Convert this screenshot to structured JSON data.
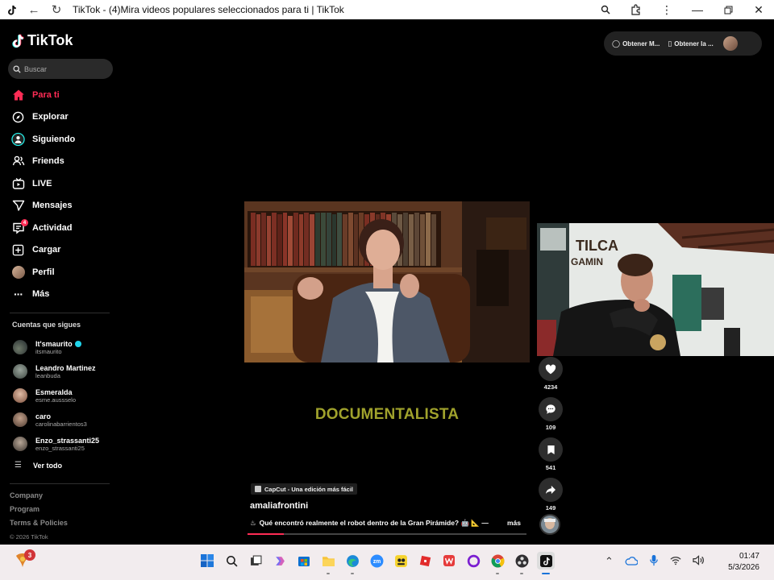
{
  "browser": {
    "title": "TikTok - (4)Mira videos populares seleccionados para ti | TikTok"
  },
  "sidebar": {
    "logo_text": "TikTok",
    "search_placeholder": "Buscar",
    "nav": [
      {
        "label": "Para ti",
        "icon": "home-icon",
        "active": true
      },
      {
        "label": "Explorar",
        "icon": "compass-icon"
      },
      {
        "label": "Siguiendo",
        "icon": "following-icon"
      },
      {
        "label": "Friends",
        "icon": "friends-icon"
      },
      {
        "label": "LIVE",
        "icon": "live-icon"
      },
      {
        "label": "Mensajes",
        "icon": "message-icon"
      },
      {
        "label": "Actividad",
        "icon": "activity-icon",
        "badge": "4"
      },
      {
        "label": "Cargar",
        "icon": "upload-icon"
      },
      {
        "label": "Perfil",
        "icon": "profile-avatar"
      },
      {
        "label": "Más",
        "icon": "more-icon"
      }
    ],
    "following_title": "Cuentas que sigues",
    "following": [
      {
        "name": "It'smaurito",
        "handle": "itsmaurito",
        "verified": true
      },
      {
        "name": "Leandro Martinez",
        "handle": "leanbuda"
      },
      {
        "name": "Esmeralda",
        "handle": "esme.aussselo"
      },
      {
        "name": "caro",
        "handle": "carolinabarrientos3"
      },
      {
        "name": "Enzo_strassanti25",
        "handle": "enzo_strassanti25"
      }
    ],
    "see_all": "Ver todo",
    "footer": [
      "Company",
      "Program",
      "Terms & Policies"
    ],
    "copyright": "© 2026 TikTok"
  },
  "topbar": {
    "get_app_1": "Obtener M...",
    "get_app_2": "Obtener la ..."
  },
  "video": {
    "overlay_text": "DOCUMENTALISTA",
    "capcut_label": "CapCut - Una edición más fácil",
    "author": "amaliafrontini",
    "description": "Qué encontró realmente el robot dentro de la Gran Pirámide? 🤖 📐 —",
    "more": "más",
    "progress": 0.13
  },
  "actions": {
    "likes": "4234",
    "comments": "109",
    "saves": "541",
    "shares": "149"
  },
  "taskbar": {
    "notification_badge": "3",
    "time": "01:47",
    "date": "5/3/2026"
  },
  "colors": {
    "accent": "#fe2c55",
    "overlay_text": "#a0a22c",
    "verified": "#20d5ec"
  }
}
